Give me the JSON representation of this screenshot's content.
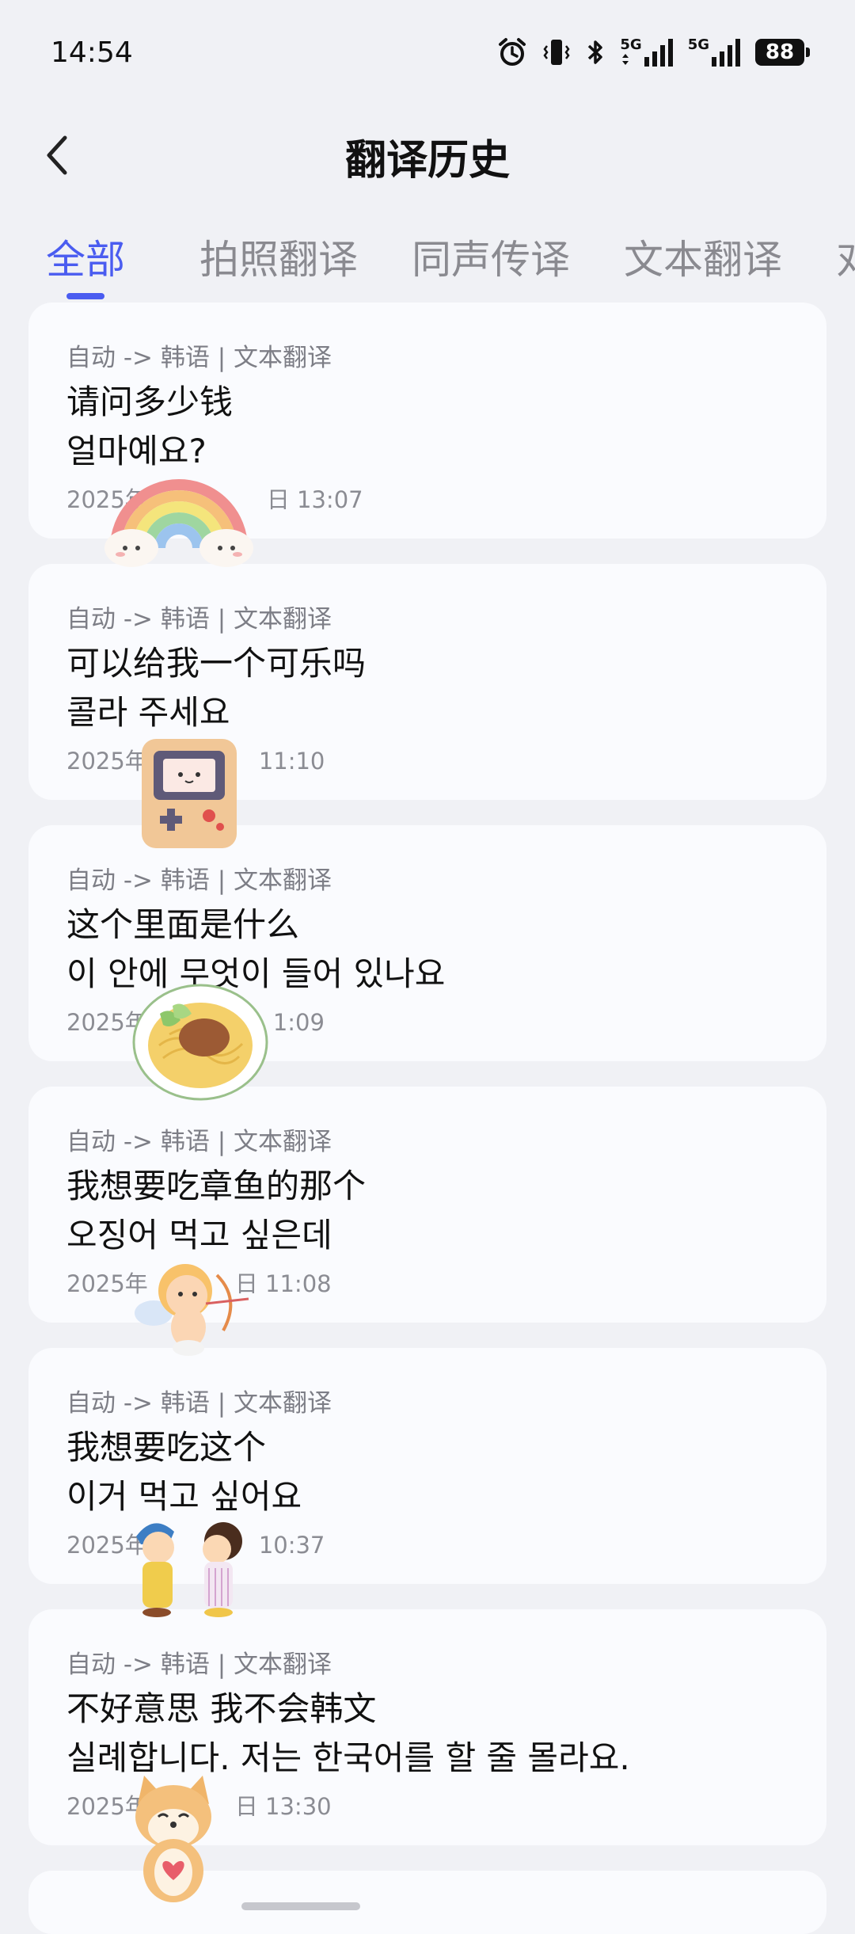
{
  "status_bar": {
    "time": "14:54",
    "network_1": "5G",
    "network_2": "5G",
    "battery": "88"
  },
  "header": {
    "title": "翻译历史"
  },
  "tabs": [
    {
      "label": "全部",
      "active": true
    },
    {
      "label": "拍照翻译",
      "active": false
    },
    {
      "label": "同声传译",
      "active": false
    },
    {
      "label": "文本翻译",
      "active": false
    },
    {
      "label": "对",
      "active": false
    }
  ],
  "history": [
    {
      "meta": "自动 -> 韩语 | 文本翻译",
      "source": "请问多少钱",
      "target": "얼마예요?",
      "time_prefix": "2025年",
      "time_suffix": "日 13:07",
      "sticker": "rainbow-sticker"
    },
    {
      "meta": "自动 -> 韩语 | 文本翻译",
      "source": "可以给我一个可乐吗",
      "target": "콜라 주세요",
      "time_prefix": "2025年",
      "time_suffix": "11:10",
      "sticker": "game-console-sticker"
    },
    {
      "meta": "自动 -> 韩语 | 文本翻译",
      "source": "这个里面是什么",
      "target": "이 안에 무엇이 들어 있나요",
      "time_prefix": "2025年",
      "time_suffix": "1:09",
      "sticker": "noodles-sticker"
    },
    {
      "meta": "自动 -> 韩语 | 文本翻译",
      "source": "我想要吃章鱼的那个",
      "target": "오징어 먹고 싶은데",
      "time_prefix": "2025年",
      "time_suffix": "日 11:08",
      "sticker": "cupid-sticker"
    },
    {
      "meta": "自动 -> 韩语 | 文本翻译",
      "source": "我想要吃这个",
      "target": "이거 먹고 싶어요",
      "time_prefix": "2025年",
      "time_suffix": "10:37",
      "sticker": "couple-sticker"
    },
    {
      "meta": "自动 -> 韩语 | 文本翻译",
      "source": "不好意思 我不会韩文",
      "target": "실례합니다. 저는 한국어를 할 줄 몰라요.",
      "time_prefix": "2025年",
      "time_suffix": "日 13:30",
      "sticker": "shiba-dog-sticker"
    }
  ],
  "colors": {
    "accent": "#4a5cf0",
    "background": "#f0f1f5",
    "card": "#fafbfe",
    "muted_text": "#7d7e86"
  }
}
